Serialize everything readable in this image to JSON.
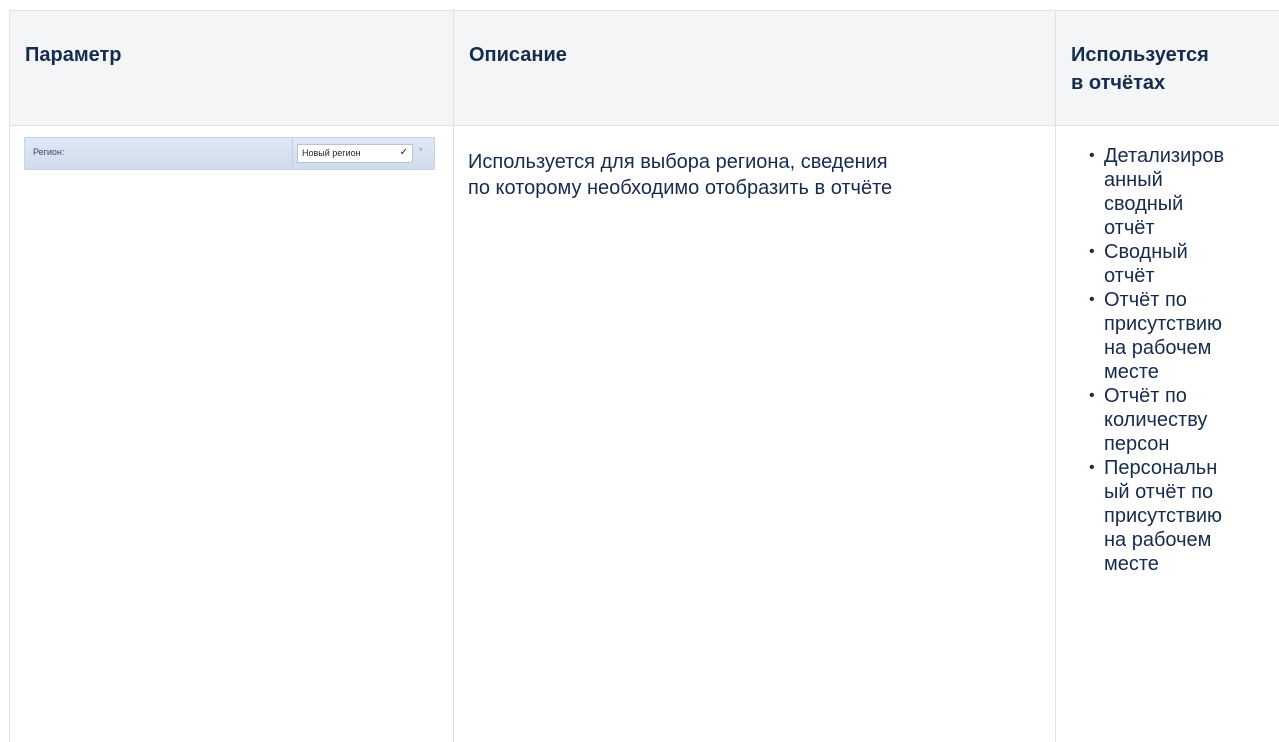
{
  "table": {
    "headers": {
      "param": "Параметр",
      "description": "Описание",
      "used_in_line1": "Используется",
      "used_in_line2": "в отчётах"
    },
    "row": {
      "form_field": {
        "label": "Регион:",
        "selected": "Новый регион",
        "required_mark": "*"
      },
      "description_line1": "Используется для выбора региона, сведения",
      "description_line2": "по которому необходимо отобразить в отчёте",
      "reports": [
        [
          "Детализиров",
          "анный",
          "сводный",
          "отчёт"
        ],
        [
          "Сводный",
          "отчёт"
        ],
        [
          "Отчёт по",
          "присутствию",
          "на рабочем",
          "месте"
        ],
        [
          "Отчёт по",
          "количеству",
          "персон"
        ],
        [
          "Персональн",
          "ый отчёт по",
          "присутствию",
          "на рабочем",
          "месте"
        ]
      ]
    }
  },
  "icons": {
    "dropdown": "chevron-down-icon",
    "bullet": "bullet-icon"
  }
}
